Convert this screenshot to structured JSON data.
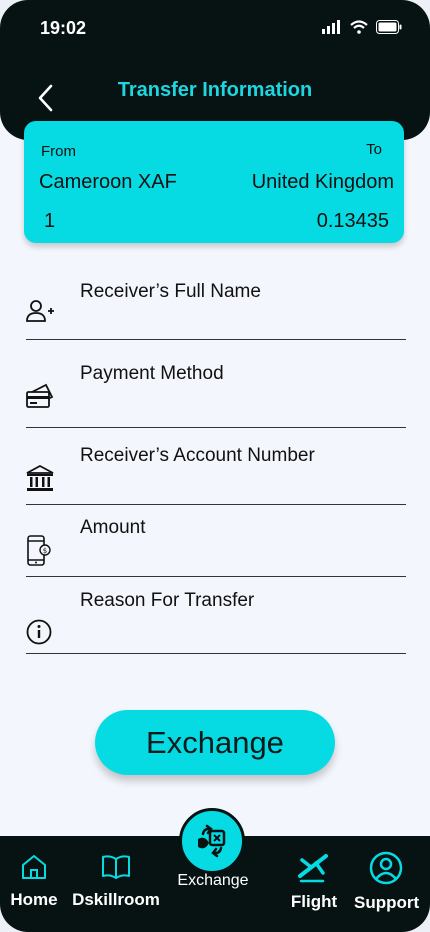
{
  "status": {
    "time": "19:02"
  },
  "header": {
    "title": "Transfer Information"
  },
  "conversion": {
    "from_label": "From",
    "to_label": "To",
    "from_currency": "Cameroon XAF",
    "to_country": "United Kingdom",
    "from_amount": "1",
    "to_amount": "0.13435"
  },
  "fields": [
    {
      "label": "Receiver’s Full Name",
      "icon": "add-user-icon"
    },
    {
      "label": "Payment Method",
      "icon": "credit-card-icon"
    },
    {
      "label": "Receiver’s Account Number",
      "icon": "bank-icon"
    },
    {
      "label": "Amount",
      "icon": "mobile-money-icon"
    },
    {
      "label": "Reason For Transfer",
      "icon": "info-icon"
    }
  ],
  "action": {
    "exchange_label": "Exchange"
  },
  "nav": {
    "home": "Home",
    "dskillroom": "Dskillroom",
    "exchange": "Exchange",
    "flight": "Flight",
    "support": "Support"
  },
  "colors": {
    "accent": "#06dbe3",
    "dark": "#071313",
    "background": "#f4f6fd"
  }
}
